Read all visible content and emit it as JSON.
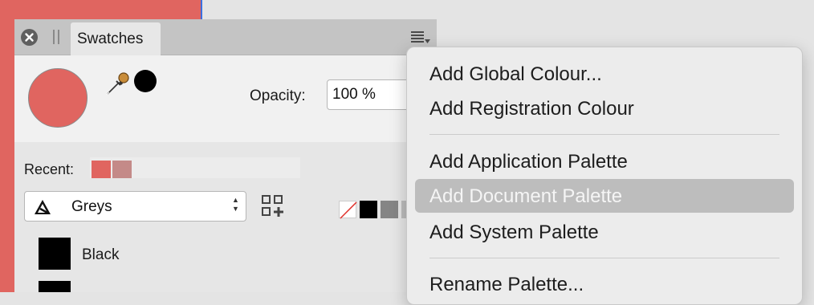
{
  "panel": {
    "tab_title": "Swatches",
    "opacity_label": "Opacity:",
    "opacity_value": "100 %",
    "recent_label": "Recent:",
    "palette_name": "Greys",
    "fill_color": "#e06560",
    "recent_colors": [
      "#e06560",
      "#c48a88"
    ],
    "swatches": [
      {
        "name": "Black",
        "color": "#000000"
      }
    ]
  },
  "menu": {
    "items": [
      {
        "label": "Add Global Colour..."
      },
      {
        "label": "Add Registration Colour"
      },
      {
        "label": "Add Application Palette"
      },
      {
        "label": "Add Document Palette"
      },
      {
        "label": "Add System Palette"
      },
      {
        "label": "Rename Palette..."
      }
    ]
  }
}
